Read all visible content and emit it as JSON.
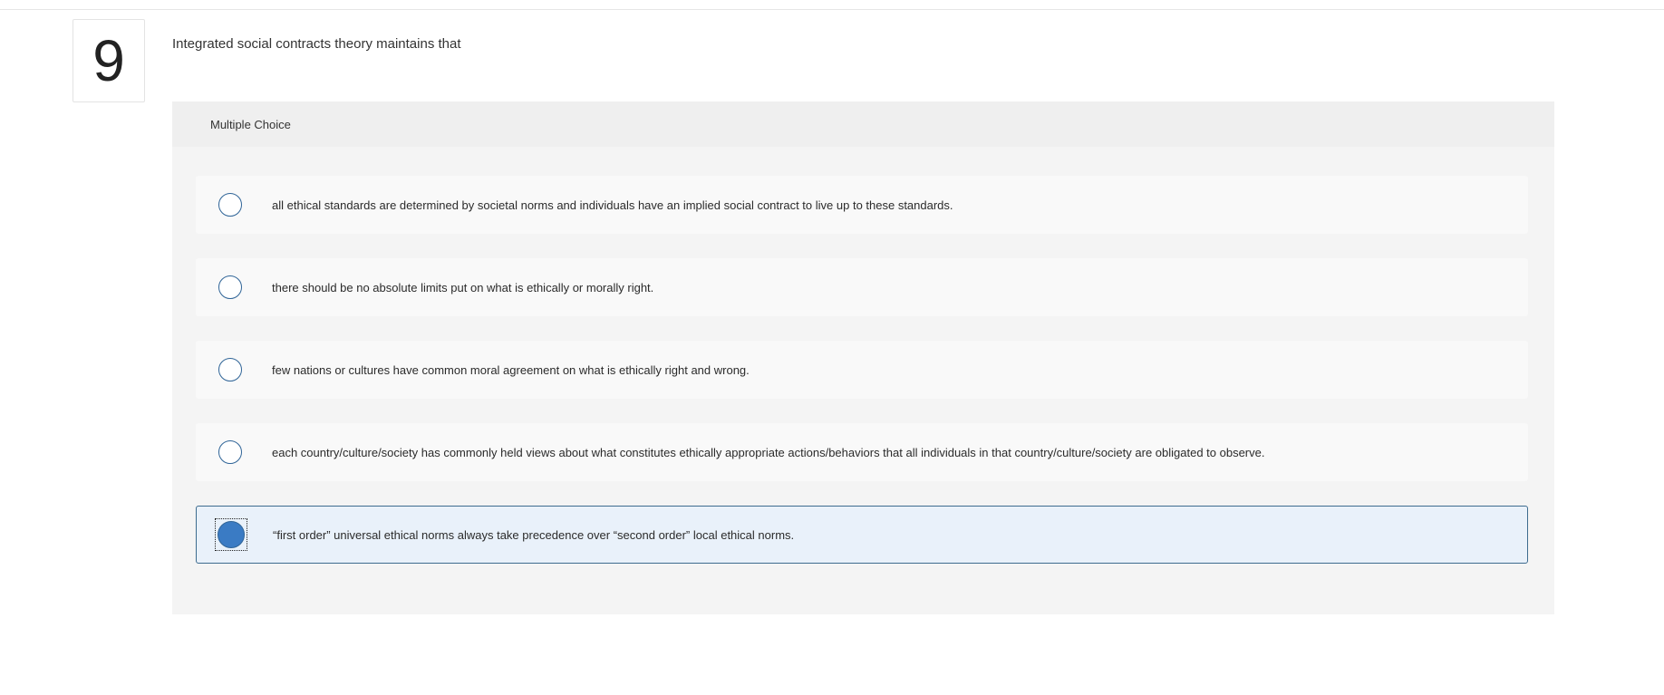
{
  "question": {
    "number": "9",
    "prompt": "Integrated social contracts theory maintains that"
  },
  "panel": {
    "header_label": "Multiple Choice"
  },
  "options": [
    {
      "text": "all ethical standards are determined by societal norms and individuals have an implied social contract to live up to these standards.",
      "selected": false
    },
    {
      "text": "there should be no absolute limits put on what is ethically or morally right.",
      "selected": false
    },
    {
      "text": "few nations or cultures have common moral agreement on what is ethically right and wrong.",
      "selected": false
    },
    {
      "text": "each country/culture/society has commonly held views about what constitutes ethically appropriate actions/behaviors that all individuals in that country/culture/society are obligated to observe.",
      "selected": false
    },
    {
      "text": "“first order” universal ethical norms always take precedence over “second order” local ethical norms.",
      "selected": true
    }
  ],
  "colors": {
    "radio_border": "#2f6497",
    "radio_checked_fill": "#3a7bc4",
    "selected_background": "#e9f1fa",
    "selected_border": "#3d6b8e",
    "panel_background": "#f4f4f4"
  }
}
